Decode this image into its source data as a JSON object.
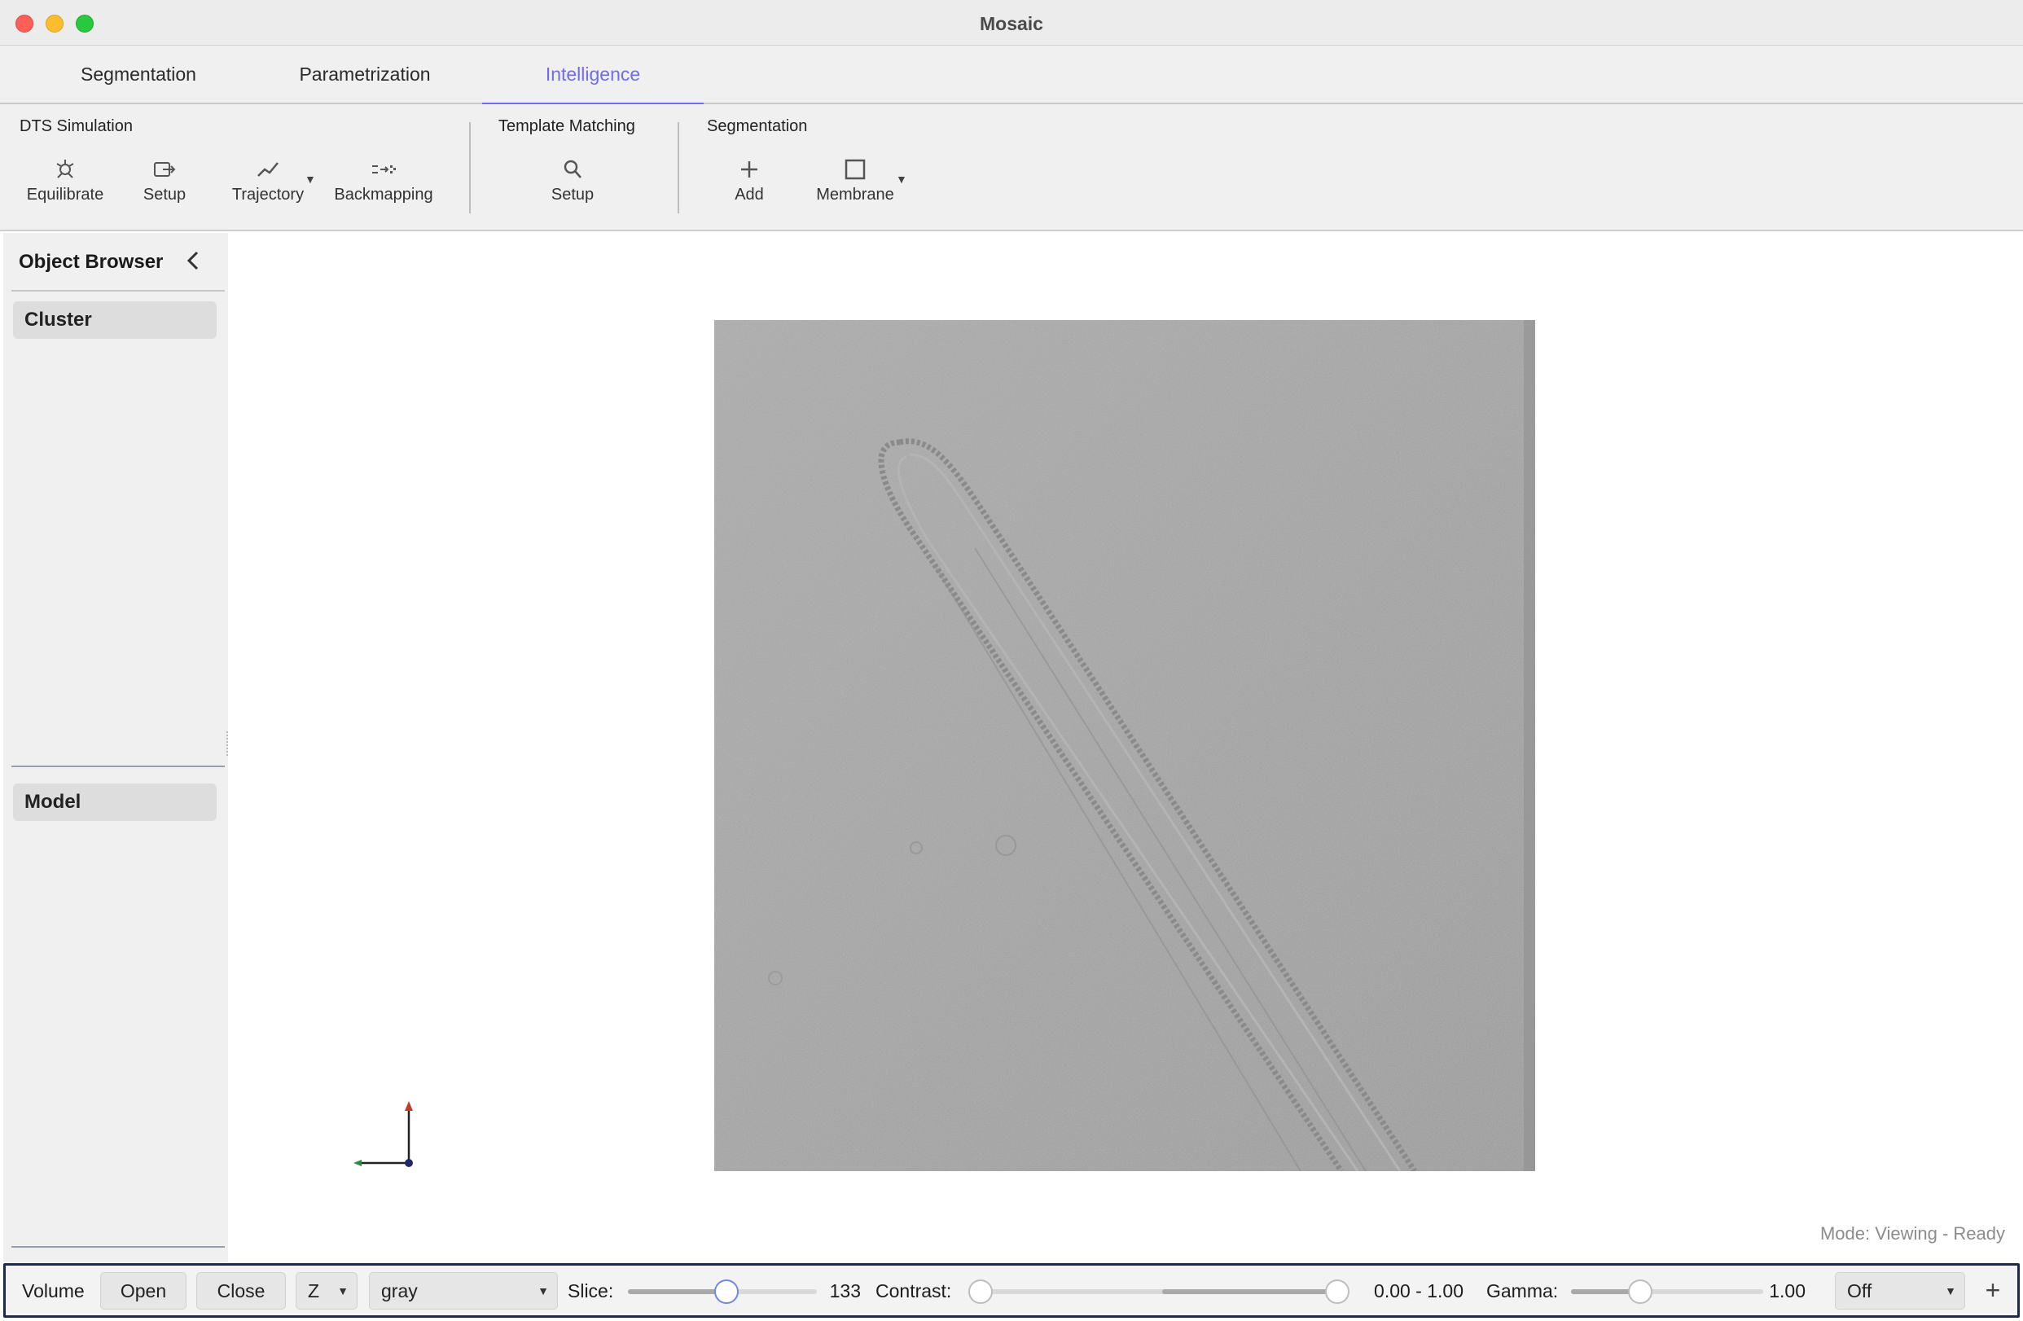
{
  "window": {
    "title": "Mosaic"
  },
  "tabs": [
    {
      "label": "Segmentation",
      "active": false
    },
    {
      "label": "Parametrization",
      "active": false
    },
    {
      "label": "Intelligence",
      "active": true
    }
  ],
  "ribbon": {
    "groups": [
      {
        "title": "DTS Simulation",
        "buttons": [
          {
            "label": "Equilibrate",
            "icon": "equilibrate-icon"
          },
          {
            "label": "Setup",
            "icon": "export-setup-icon"
          },
          {
            "label": "Trajectory",
            "icon": "trajectory-icon",
            "has_menu": true
          },
          {
            "label": "Backmapping",
            "icon": "backmapping-icon"
          }
        ]
      },
      {
        "title": "Template Matching",
        "buttons": [
          {
            "label": "Setup",
            "icon": "search-icon"
          }
        ]
      },
      {
        "title": "Segmentation",
        "buttons": [
          {
            "label": "Add",
            "icon": "plus-icon"
          },
          {
            "label": "Membrane",
            "icon": "square-icon",
            "has_menu": true
          }
        ]
      }
    ]
  },
  "sidebar": {
    "title": "Object Browser",
    "sections": [
      {
        "label": "Cluster"
      },
      {
        "label": "Model"
      }
    ]
  },
  "viewport": {
    "mode_text": "Mode: Viewing - Ready"
  },
  "bottombar": {
    "volume_label": "Volume",
    "open_label": "Open",
    "close_label": "Close",
    "axis_value": "Z",
    "colormap_value": "gray",
    "slice_label": "Slice:",
    "slice_value": "133",
    "slice_fraction": 0.52,
    "contrast_label": "Contrast:",
    "contrast_value": "0.00 - 1.00",
    "gamma_label": "Gamma:",
    "gamma_value": "1.00",
    "gamma_fraction": 0.36,
    "mode_select_value": "Off",
    "add_label": "+"
  },
  "colors": {
    "accent": "#6f6cf2",
    "toolbar_border": "#1e2a4a",
    "slider_thumb_accent": "#6c8ae4"
  }
}
